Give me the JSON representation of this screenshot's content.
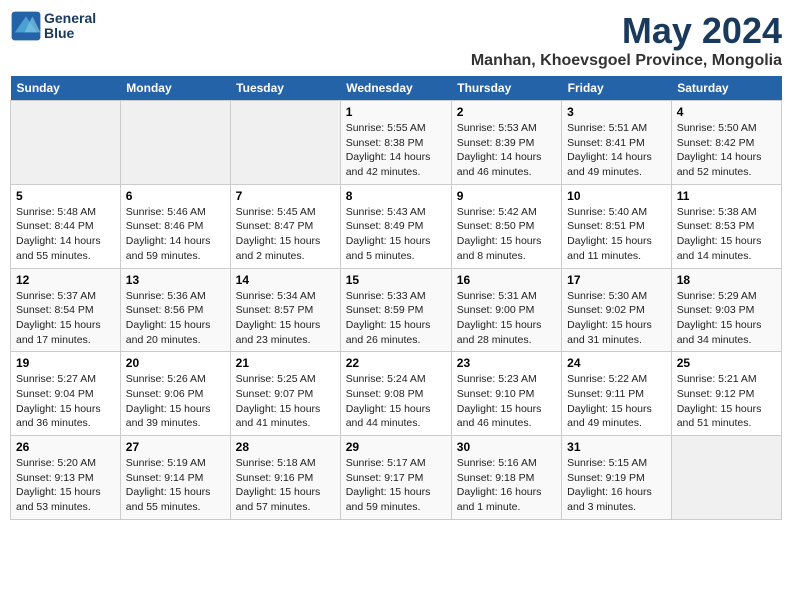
{
  "header": {
    "logo_line1": "General",
    "logo_line2": "Blue",
    "month_year": "May 2024",
    "location": "Manhan, Khoevsgoel Province, Mongolia"
  },
  "days_of_week": [
    "Sunday",
    "Monday",
    "Tuesday",
    "Wednesday",
    "Thursday",
    "Friday",
    "Saturday"
  ],
  "weeks": [
    [
      {
        "day": "",
        "info": ""
      },
      {
        "day": "",
        "info": ""
      },
      {
        "day": "",
        "info": ""
      },
      {
        "day": "1",
        "info": "Sunrise: 5:55 AM\nSunset: 8:38 PM\nDaylight: 14 hours\nand 42 minutes."
      },
      {
        "day": "2",
        "info": "Sunrise: 5:53 AM\nSunset: 8:39 PM\nDaylight: 14 hours\nand 46 minutes."
      },
      {
        "day": "3",
        "info": "Sunrise: 5:51 AM\nSunset: 8:41 PM\nDaylight: 14 hours\nand 49 minutes."
      },
      {
        "day": "4",
        "info": "Sunrise: 5:50 AM\nSunset: 8:42 PM\nDaylight: 14 hours\nand 52 minutes."
      }
    ],
    [
      {
        "day": "5",
        "info": "Sunrise: 5:48 AM\nSunset: 8:44 PM\nDaylight: 14 hours\nand 55 minutes."
      },
      {
        "day": "6",
        "info": "Sunrise: 5:46 AM\nSunset: 8:46 PM\nDaylight: 14 hours\nand 59 minutes."
      },
      {
        "day": "7",
        "info": "Sunrise: 5:45 AM\nSunset: 8:47 PM\nDaylight: 15 hours\nand 2 minutes."
      },
      {
        "day": "8",
        "info": "Sunrise: 5:43 AM\nSunset: 8:49 PM\nDaylight: 15 hours\nand 5 minutes."
      },
      {
        "day": "9",
        "info": "Sunrise: 5:42 AM\nSunset: 8:50 PM\nDaylight: 15 hours\nand 8 minutes."
      },
      {
        "day": "10",
        "info": "Sunrise: 5:40 AM\nSunset: 8:51 PM\nDaylight: 15 hours\nand 11 minutes."
      },
      {
        "day": "11",
        "info": "Sunrise: 5:38 AM\nSunset: 8:53 PM\nDaylight: 15 hours\nand 14 minutes."
      }
    ],
    [
      {
        "day": "12",
        "info": "Sunrise: 5:37 AM\nSunset: 8:54 PM\nDaylight: 15 hours\nand 17 minutes."
      },
      {
        "day": "13",
        "info": "Sunrise: 5:36 AM\nSunset: 8:56 PM\nDaylight: 15 hours\nand 20 minutes."
      },
      {
        "day": "14",
        "info": "Sunrise: 5:34 AM\nSunset: 8:57 PM\nDaylight: 15 hours\nand 23 minutes."
      },
      {
        "day": "15",
        "info": "Sunrise: 5:33 AM\nSunset: 8:59 PM\nDaylight: 15 hours\nand 26 minutes."
      },
      {
        "day": "16",
        "info": "Sunrise: 5:31 AM\nSunset: 9:00 PM\nDaylight: 15 hours\nand 28 minutes."
      },
      {
        "day": "17",
        "info": "Sunrise: 5:30 AM\nSunset: 9:02 PM\nDaylight: 15 hours\nand 31 minutes."
      },
      {
        "day": "18",
        "info": "Sunrise: 5:29 AM\nSunset: 9:03 PM\nDaylight: 15 hours\nand 34 minutes."
      }
    ],
    [
      {
        "day": "19",
        "info": "Sunrise: 5:27 AM\nSunset: 9:04 PM\nDaylight: 15 hours\nand 36 minutes."
      },
      {
        "day": "20",
        "info": "Sunrise: 5:26 AM\nSunset: 9:06 PM\nDaylight: 15 hours\nand 39 minutes."
      },
      {
        "day": "21",
        "info": "Sunrise: 5:25 AM\nSunset: 9:07 PM\nDaylight: 15 hours\nand 41 minutes."
      },
      {
        "day": "22",
        "info": "Sunrise: 5:24 AM\nSunset: 9:08 PM\nDaylight: 15 hours\nand 44 minutes."
      },
      {
        "day": "23",
        "info": "Sunrise: 5:23 AM\nSunset: 9:10 PM\nDaylight: 15 hours\nand 46 minutes."
      },
      {
        "day": "24",
        "info": "Sunrise: 5:22 AM\nSunset: 9:11 PM\nDaylight: 15 hours\nand 49 minutes."
      },
      {
        "day": "25",
        "info": "Sunrise: 5:21 AM\nSunset: 9:12 PM\nDaylight: 15 hours\nand 51 minutes."
      }
    ],
    [
      {
        "day": "26",
        "info": "Sunrise: 5:20 AM\nSunset: 9:13 PM\nDaylight: 15 hours\nand 53 minutes."
      },
      {
        "day": "27",
        "info": "Sunrise: 5:19 AM\nSunset: 9:14 PM\nDaylight: 15 hours\nand 55 minutes."
      },
      {
        "day": "28",
        "info": "Sunrise: 5:18 AM\nSunset: 9:16 PM\nDaylight: 15 hours\nand 57 minutes."
      },
      {
        "day": "29",
        "info": "Sunrise: 5:17 AM\nSunset: 9:17 PM\nDaylight: 15 hours\nand 59 minutes."
      },
      {
        "day": "30",
        "info": "Sunrise: 5:16 AM\nSunset: 9:18 PM\nDaylight: 16 hours\nand 1 minute."
      },
      {
        "day": "31",
        "info": "Sunrise: 5:15 AM\nSunset: 9:19 PM\nDaylight: 16 hours\nand 3 minutes."
      },
      {
        "day": "",
        "info": ""
      }
    ]
  ]
}
